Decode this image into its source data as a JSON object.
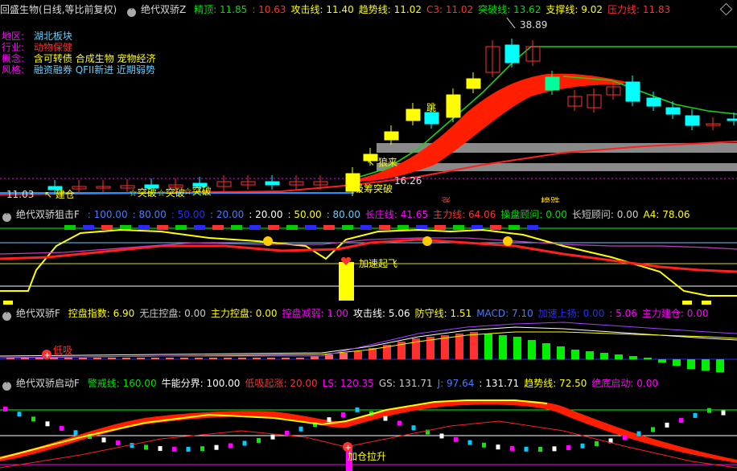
{
  "header": {
    "stock": "回盛生物",
    "period": "(日线,等比前复权)",
    "indicator": "绝代双骄Z",
    "params": [
      {
        "label": "精顶: 11.85",
        "color": "#00e000"
      },
      {
        "label": ": 10.63",
        "color": "#ff3030"
      },
      {
        "label": "攻击线: 11.40",
        "color": "#ffff00"
      },
      {
        "label": "趋势线: 11.02",
        "color": "#ffff00"
      },
      {
        "label": "C3: 11.02",
        "color": "#ff3030"
      },
      {
        "label": "突破线: 13.62",
        "color": "#00e000"
      },
      {
        "label": "支撑线: 9.02",
        "color": "#ffff00"
      },
      {
        "label": "压力线: 11.83",
        "color": "#ff3030"
      }
    ]
  },
  "info": {
    "region_label": "地区:",
    "region_value": "湖北板块",
    "industry_label": "行业:",
    "industry_value": "动物保健",
    "concept_label": "概念:",
    "concept_value": "含可转债 合成生物 宠物经济",
    "style_label": "风格:",
    "style_value": "融资融券 QFII新进 近期弱势"
  },
  "main_chart": {
    "price_high_label": "38.89",
    "price_mid_label": "16.26",
    "price_low_label": "11.03",
    "signal_jian": "↖ 建仓",
    "signal_tupo1": "☆突破",
    "signal_tupo2": "☆突破",
    "signal_tupo3": "☆突破",
    "signal_xichou": "吸筹突破",
    "signal_lang": "↖ 狼来",
    "signal_tiao": "跳",
    "tag_zhang": "涨",
    "tag_bangdie": "榜跌"
  },
  "panel2": {
    "indicator": "绝代双骄狙击F",
    "params": [
      {
        "label": ": 100.00",
        "color": "#4a7bff"
      },
      {
        "label": ": 80.00",
        "color": "#4a7bff"
      },
      {
        "label": ": 50.00",
        "color": "#2a2aff"
      },
      {
        "label": ": 20.00",
        "color": "#4a7bff"
      },
      {
        "label": ": 20.00",
        "color": "#ffffff"
      },
      {
        "label": ": 50.00",
        "color": "#ffff00"
      },
      {
        "label": ": 80.00",
        "color": "#66ccff"
      },
      {
        "label": "长庄线: 41.65",
        "color": "#ff00ff"
      },
      {
        "label": "主力线: 64.06",
        "color": "#ff3030"
      },
      {
        "label": "操盘顾问: 0.00",
        "color": "#00e000"
      },
      {
        "label": "长短顾问: 0.00",
        "color": "#cccccc"
      },
      {
        "label": "A4: 78.06",
        "color": "#ffff00"
      }
    ],
    "signal": "加速起飞"
  },
  "panel3": {
    "indicator": "绝代双骄F",
    "params": [
      {
        "label": "控盘指数: 6.90",
        "color": "#ffff00"
      },
      {
        "label": "无庄控盘: 0.00",
        "color": "#cccccc"
      },
      {
        "label": "主力控盘: 0.00",
        "color": "#ffff00"
      },
      {
        "label": "控盘减弱: 1.00",
        "color": "#ff00ff"
      },
      {
        "label": "攻击线: 5.06",
        "color": "#ffffff"
      },
      {
        "label": "防守线: 1.51",
        "color": "#ffff00"
      },
      {
        "label": "MACD: 7.10",
        "color": "#4a7bff"
      },
      {
        "label": "加速上扬: 0.00",
        "color": "#2a2aff"
      },
      {
        "label": ": 5.06",
        "color": "#ff00ff"
      },
      {
        "label": "主力建仓: 0.00",
        "color": "#ff00ff"
      }
    ],
    "signal": "低吸"
  },
  "panel4": {
    "indicator": "绝代双骄启动F",
    "params": [
      {
        "label": "警戒线: 160.00",
        "color": "#00e000"
      },
      {
        "label": "牛能分界: 100.00",
        "color": "#ffffff"
      },
      {
        "label": "低吸起涨: 20.00",
        "color": "#ff3030"
      },
      {
        "label": "LS: 120.35",
        "color": "#ff00ff"
      },
      {
        "label": "GS: 131.71",
        "color": "#cccccc"
      },
      {
        "label": "J: 97.64",
        "color": "#4a7bff"
      },
      {
        "label": ": 131.71",
        "color": "#ffffff"
      },
      {
        "label": "趋势线: 72.50",
        "color": "#ffff00"
      },
      {
        "label": "绝底启动: 0.00",
        "color": "#ff00ff"
      }
    ],
    "signal": "加仓拉升"
  }
}
